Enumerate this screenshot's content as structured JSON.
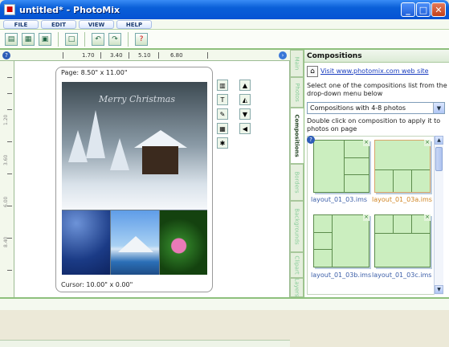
{
  "window": {
    "title": "untitled* - PhotoMix",
    "min": "_",
    "max": "□",
    "close": "✕"
  },
  "menu": [
    "FILE",
    "EDIT",
    "VIEW",
    "HELP"
  ],
  "toolbar": {
    "buttons": [
      "new-icon",
      "open-icon",
      "save-icon",
      "frame-icon",
      "undo-icon",
      "redo-icon",
      "help-icon"
    ]
  },
  "ruler": {
    "labels": [
      "1.70",
      "3.40",
      "5.10",
      "6.80"
    ],
    "vlabels": [
      "1.20",
      "2.40",
      "3.60",
      "4.80",
      "6.00",
      "7.20",
      "8.40"
    ]
  },
  "page": {
    "size_label": "Page: 8.50\" x 11.00\"",
    "cursor_label": "Cursor: 10.00\" x 0.00\"",
    "photo_caption": "Merry Christmas"
  },
  "tabs": [
    "Main",
    "Photos",
    "Compositions",
    "Borders",
    "Backgrounds",
    "Clipart",
    "Layers"
  ],
  "active_tab": "Compositions",
  "panel": {
    "title": "Compositions",
    "link": "Visit www.photomix.com web site",
    "instruction": "Select one of the compositions list from the drop-down menu below",
    "dropdown_value": "Compositions with 4-8 photos",
    "hint": "Double click on composition to apply it to photos on page",
    "thumbnails": [
      {
        "label": "layout_01_03.ims",
        "selected": false
      },
      {
        "label": "layout_01_03a.ims",
        "selected": true
      },
      {
        "label": "layout_01_03b.ims",
        "selected": false
      },
      {
        "label": "layout_01_03c.ims",
        "selected": false
      }
    ]
  },
  "colors": {
    "accent_green": "#8ec07d",
    "thumb_fill": "#cbeebf",
    "link_blue": "#1a3dbf",
    "selected_label": "#d08420"
  }
}
